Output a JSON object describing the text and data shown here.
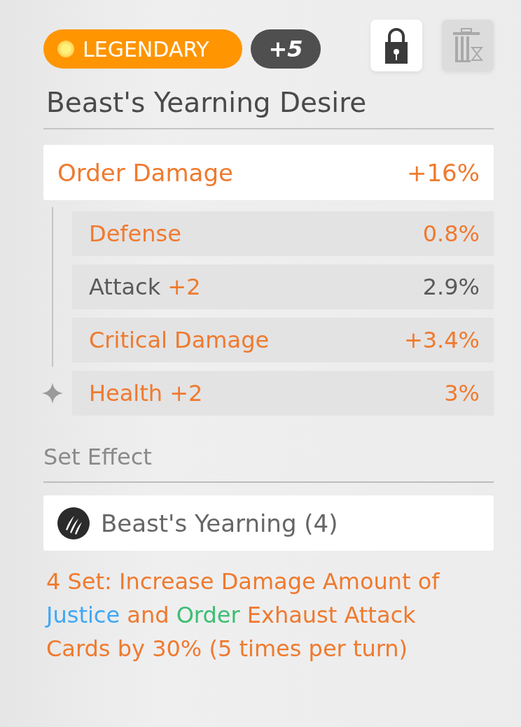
{
  "rarity": {
    "label": "LEGENDARY"
  },
  "level_badge": "+5",
  "actions": {
    "lock": {
      "on": true
    },
    "recycle": {
      "disabled": true
    }
  },
  "title": "Beast's Yearning Desire",
  "main_stat": {
    "name": "Order Damage",
    "value": "+16%"
  },
  "substats": [
    {
      "name": "Defense",
      "value": "0.8%",
      "highlighted": true,
      "starred": false
    },
    {
      "name": "Attack",
      "bonus": "+2",
      "value": "2.9%",
      "highlighted": false,
      "starred": false
    },
    {
      "name": "Critical Damage",
      "value": "+3.4%",
      "highlighted": true,
      "starred": false
    },
    {
      "name": "Health",
      "bonus": "+2",
      "value": "3%",
      "highlighted": true,
      "starred": true
    }
  ],
  "set_effect": {
    "heading": "Set Effect",
    "set_name": "Beast's Yearning (4)",
    "description": [
      {
        "text": "4 Set: Increase Damage Amount of ",
        "color": "#ef7a2e"
      },
      {
        "text": "Justice",
        "color": "#3ea8f5"
      },
      {
        "text": " and ",
        "color": "#ef7a2e"
      },
      {
        "text": "Order",
        "color": "#3dbf72"
      },
      {
        "text": " Exhaust Attack Cards by 30% (5 times per turn)",
        "color": "#ef7a2e"
      }
    ]
  }
}
